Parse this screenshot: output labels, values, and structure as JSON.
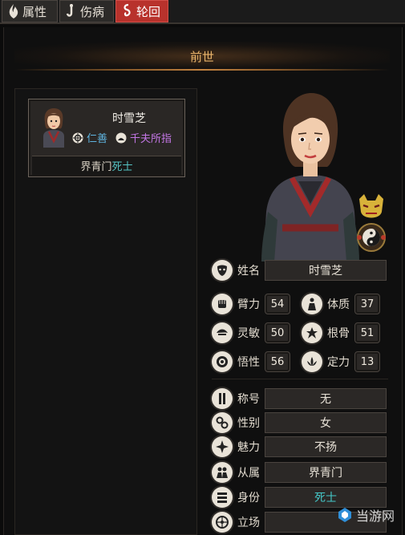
{
  "tabs": [
    {
      "label": "属性",
      "icon": "flame-icon",
      "active": false
    },
    {
      "label": "伤病",
      "icon": "hook-icon",
      "active": false
    },
    {
      "label": "轮回",
      "icon": "spiral-icon",
      "active": true
    }
  ],
  "section_title": "前世",
  "character_card": {
    "name": "时雪芝",
    "morality": "仁善",
    "title": "千夫所指",
    "sect": "界青门",
    "rank": "死士"
  },
  "fields": {
    "name": {
      "label": "姓名",
      "value": "时雪芝",
      "icon": "mask-icon"
    },
    "arm_strength": {
      "label": "臂力",
      "value": "54",
      "icon": "fist-icon"
    },
    "constitution": {
      "label": "体质",
      "value": "37",
      "icon": "body-icon"
    },
    "agility": {
      "label": "灵敏",
      "value": "50",
      "icon": "swift-icon"
    },
    "bone": {
      "label": "根骨",
      "value": "51",
      "icon": "bone-icon"
    },
    "comprehension": {
      "label": "悟性",
      "value": "56",
      "icon": "eye-icon"
    },
    "composure": {
      "label": "定力",
      "value": "13",
      "icon": "lotus-icon"
    },
    "nickname": {
      "label": "称号",
      "value": "无",
      "icon": "banner-icon"
    },
    "gender": {
      "label": "性别",
      "value": "女",
      "icon": "gender-icon"
    },
    "charm": {
      "label": "魅力",
      "value": "不扬",
      "icon": "star-icon"
    },
    "affiliation": {
      "label": "从属",
      "value": "界青门",
      "icon": "group-icon"
    },
    "identity": {
      "label": "身份",
      "value": "死士",
      "icon": "rank-icon"
    },
    "stance": {
      "label": "立场",
      "value": "",
      "icon": "wheel-icon"
    }
  },
  "watermark": "当游网",
  "colors": {
    "accent_red": "#b8322c",
    "header_gold": "#e9b46a",
    "teal": "#45c9c9",
    "good_blue": "#5fb4e0",
    "title_purple": "#c477e6"
  }
}
